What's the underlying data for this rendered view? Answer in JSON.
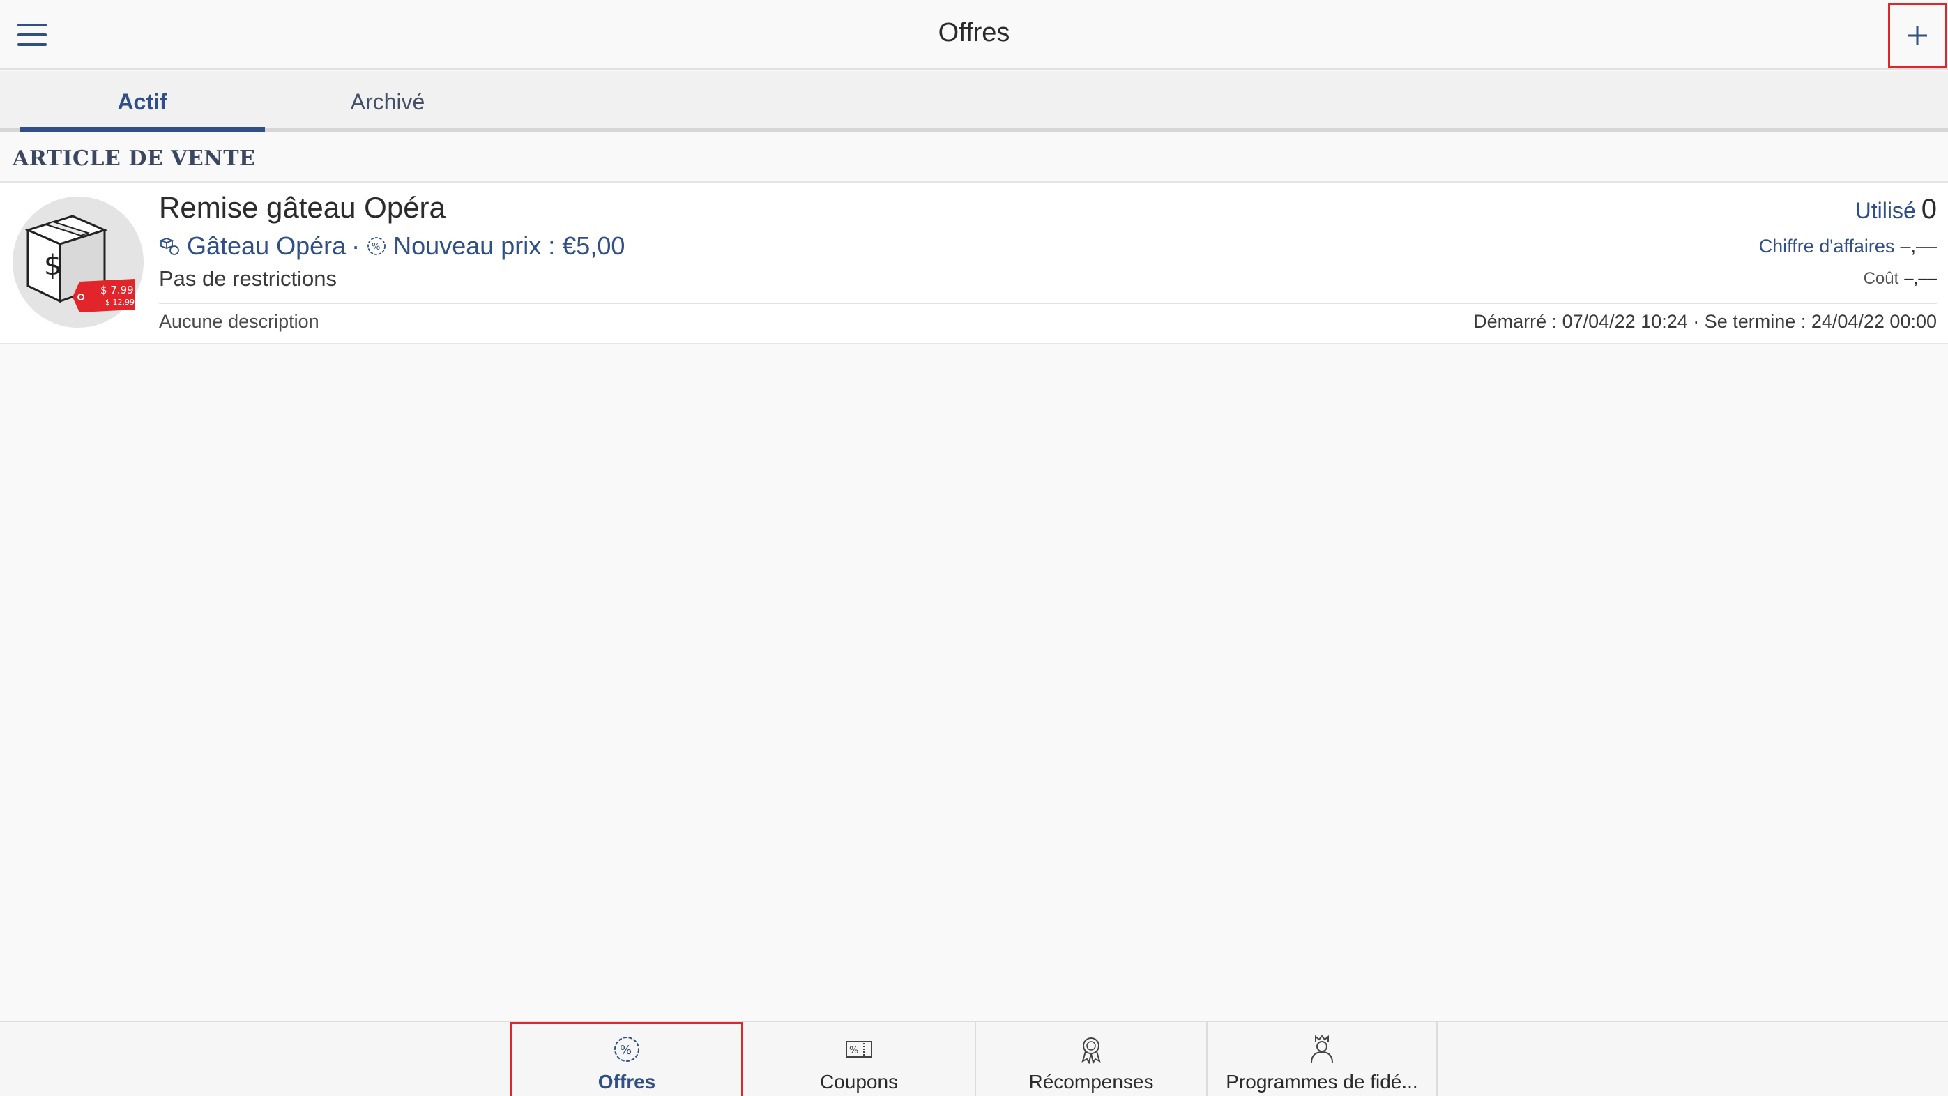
{
  "header": {
    "title": "Offres",
    "menu_icon": "hamburger-menu-icon",
    "add_icon": "plus-icon"
  },
  "tabs": [
    {
      "label": "Actif",
      "active": true
    },
    {
      "label": "Archivé",
      "active": false
    }
  ],
  "section": {
    "heading": "ARTICLE DE VENTE"
  },
  "offer": {
    "title": "Remise gâteau Opéra",
    "item_name": "Gâteau Opéra",
    "separator": "·",
    "price_label": "Nouveau prix : €5,00",
    "restrictions": "Pas de restrictions",
    "description": "Aucune description",
    "used_label": "Utilisé",
    "used_value": "0",
    "revenue_label": "Chiffre d'affaires",
    "revenue_value": "–,––",
    "cost_label": "Coût",
    "cost_value": "–,––",
    "dates": "Démarré : 07/04/22 10:24 · Se termine : 24/04/22 00:00",
    "thumb_price_new": "$ 7.99",
    "thumb_price_old": "$ 12.99"
  },
  "bottom_nav": [
    {
      "label": "Offres",
      "icon": "percent-badge-icon",
      "active": true
    },
    {
      "label": "Coupons",
      "icon": "coupon-icon",
      "active": false
    },
    {
      "label": "Récompenses",
      "icon": "award-ribbon-icon",
      "active": false
    },
    {
      "label": "Programmes de fidé...",
      "icon": "king-person-icon",
      "active": false
    }
  ],
  "colors": {
    "accent": "#2f4f86",
    "highlight": "#e0262a",
    "background": "#f9f9f9"
  }
}
